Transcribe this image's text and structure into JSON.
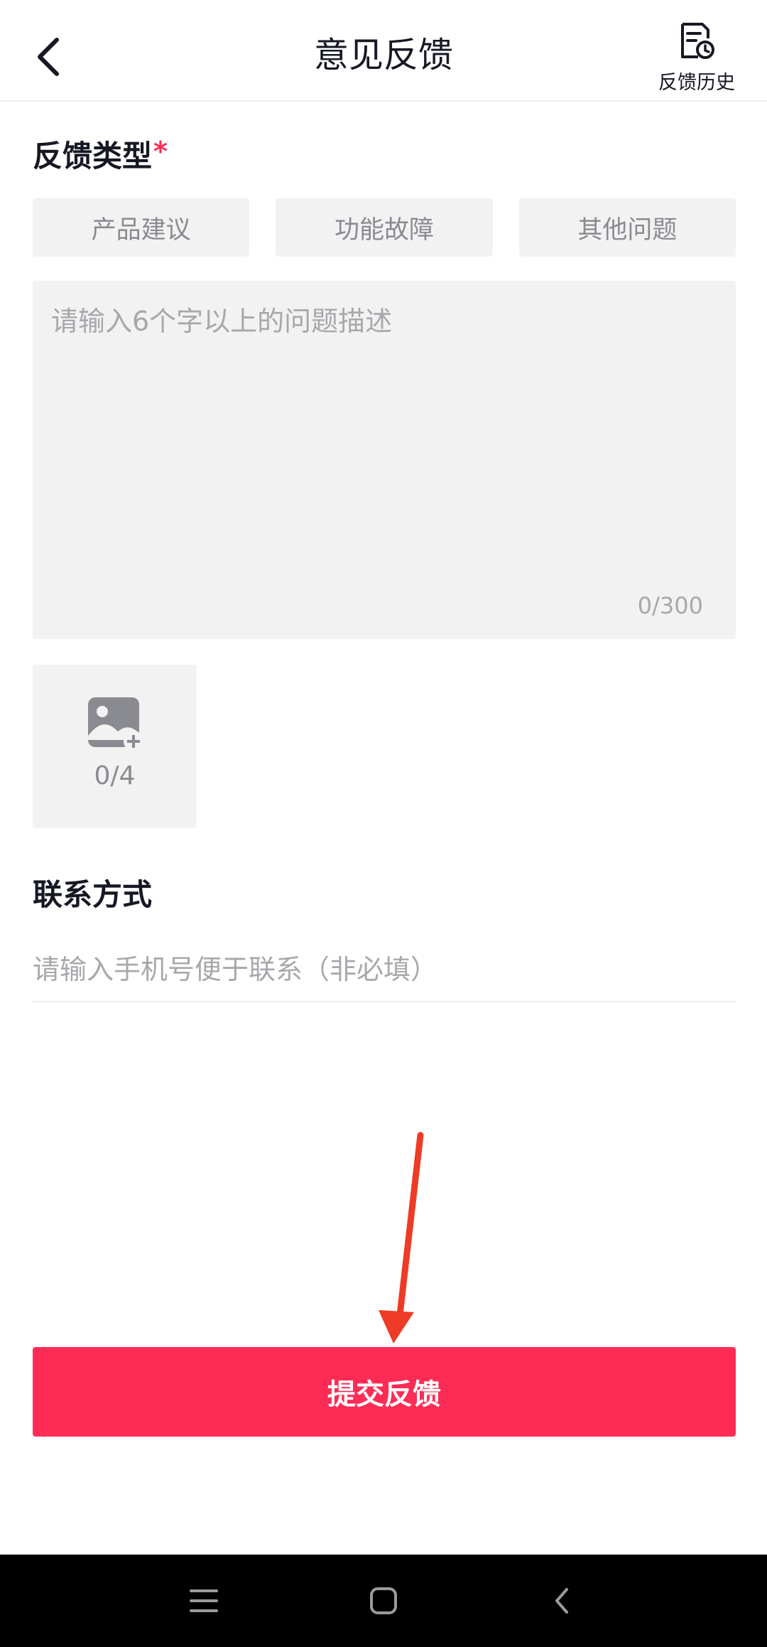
{
  "header": {
    "title": "意见反馈",
    "history_label": "反馈历史",
    "icons": {
      "back": "chevron-left-icon",
      "history": "document-clock-icon"
    }
  },
  "feedback_type": {
    "label": "反馈类型",
    "required_mark": "*",
    "options": [
      "产品建议",
      "功能故障",
      "其他问题"
    ]
  },
  "description": {
    "placeholder": "请输入6个字以上的问题描述",
    "value": "",
    "counter": "0/300"
  },
  "upload": {
    "count": "0/4",
    "icon": "add-image-icon"
  },
  "contact": {
    "label": "联系方式",
    "placeholder": "请输入手机号便于联系（非必填）",
    "value": ""
  },
  "submit": {
    "label": "提交反馈"
  },
  "nav_bar": {
    "icons": [
      "menu-icon",
      "home-square-icon",
      "back-chevron-icon"
    ]
  },
  "colors": {
    "accent": "#fe2c55",
    "arrow": "#ee3b25",
    "chip_bg": "#f2f2f2",
    "placeholder": "#a7a8ac",
    "nav_bg": "#000000"
  }
}
